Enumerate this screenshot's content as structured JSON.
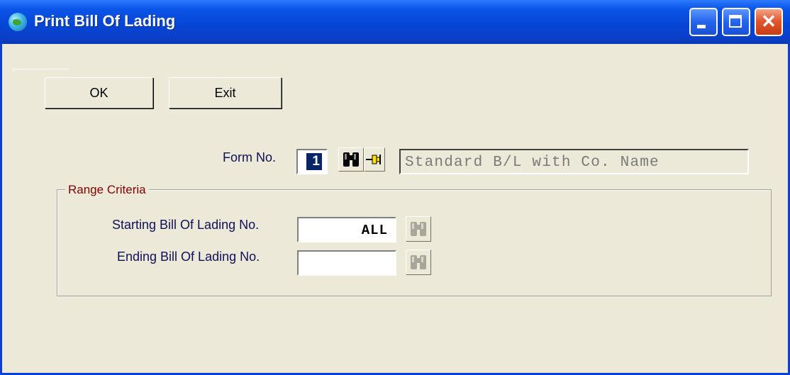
{
  "window": {
    "title": "Print Bill Of Lading"
  },
  "toolbar": {
    "ok_label": "OK",
    "exit_label": "Exit"
  },
  "form": {
    "form_no_label": "Form No.",
    "form_no_value": "1",
    "form_name": "Standard B/L with Co. Name"
  },
  "range": {
    "legend": "Range Criteria",
    "starting_label": "Starting Bill Of Lading No.",
    "starting_value": "ALL",
    "ending_label": "Ending Bill Of Lading No.",
    "ending_value": ""
  },
  "icons": {
    "title": "globe-icon",
    "lookup": "binoculars-icon",
    "pin": "pushpin-icon"
  },
  "colors": {
    "titlebar": "#0646d6",
    "dialog_bg": "#ece9d8",
    "label_text": "#10105a",
    "group_legend": "#800000",
    "selection": "#0a246a"
  }
}
